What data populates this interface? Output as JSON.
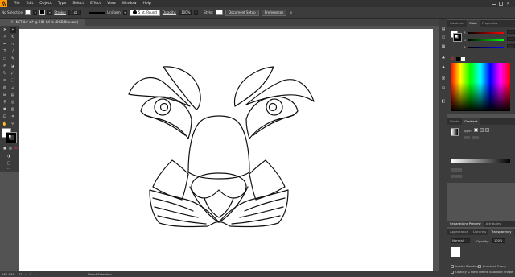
{
  "app": {
    "name": "Illustrator",
    "brand_color": "#ff9a00"
  },
  "menubar": {
    "items": [
      "File",
      "Edit",
      "Object",
      "Type",
      "Select",
      "Effect",
      "View",
      "Window",
      "Help"
    ]
  },
  "controlbar": {
    "selection": "No Selection",
    "stroke_label": "Stroke:",
    "stroke_value": "1 pt",
    "profile_label": "Uniform",
    "brush_label": "5 pt. Round",
    "opacity_label": "Opacity:",
    "opacity_value": "100%",
    "style_label": "Style:",
    "document_setup": "Document Setup",
    "preferences": "Preferences"
  },
  "document": {
    "tab_label": "NFT Art.ai* @ 181.94 % (RGB/Preview)"
  },
  "statusbar": {
    "zoom": "181.94%",
    "angle": "0°",
    "artboard": "1",
    "tool": "Direct Selection"
  },
  "panels": {
    "color_tabs": [
      "Swatches",
      "Color",
      "Properties"
    ],
    "color_active": "Color",
    "color_channels": [
      "R",
      "G",
      "B"
    ],
    "gradient_tabs": [
      "Stroke",
      "Gradient"
    ],
    "gradient_active": "Gradient",
    "gradient_type_label": "Type:",
    "transparency_tabs": [
      "Appearance",
      "Libraries",
      "Transparency"
    ],
    "transparency_active": "Transparency",
    "separations_tabs": [
      "Separations Preview",
      "Attributes"
    ],
    "blend_mode": "Normal",
    "opacity_label": "Opacity:",
    "opacity_value": "100%",
    "isolate_blending": "Isolate Blending",
    "knockout_group": "Knockout Group",
    "opacity_mask": "Opacity & Mask Define Knockout Shape"
  }
}
